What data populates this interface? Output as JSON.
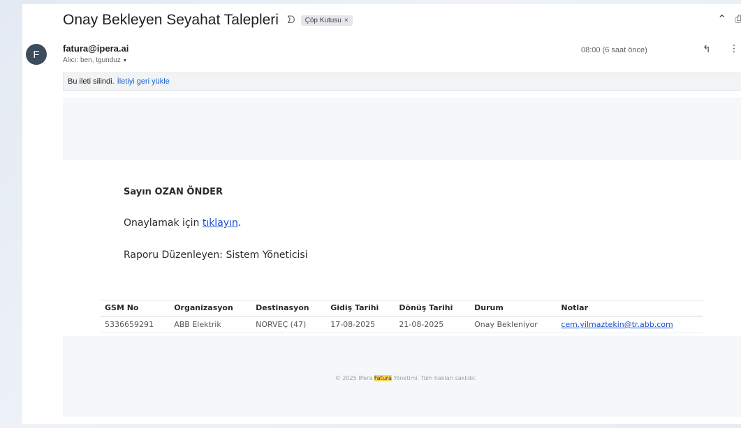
{
  "email": {
    "subject": "Onay Bekleyen Seyahat Talepleri",
    "label_chip": "Çöp Kutusu",
    "sender": "fatura@ipera.ai",
    "avatar_letter": "F",
    "recipients": "Alıcı: ben, tgunduz",
    "time": "08:00 (6 saat önce)"
  },
  "deleted_notice": {
    "text": "Bu ileti silindi.",
    "restore_link": "İletiyi geri yükle"
  },
  "body": {
    "greeting": "Sayın OZAN ÖNDER",
    "approve_prefix": "Onaylamak için ",
    "approve_link": "tıklayın",
    "approve_suffix": ".",
    "author": "Raporu Düzenleyen: Sistem Yöneticisi"
  },
  "table": {
    "headers": [
      "GSM No",
      "Organizasyon",
      "Destinasyon",
      "Gidiş Tarihi",
      "Dönüş Tarihi",
      "Durum",
      "Notlar"
    ],
    "rows": [
      [
        "5336659291",
        "ABB Elektrik",
        "NORVEÇ (47)",
        "17-08-2025",
        "21-08-2025",
        "Onay Bekleniyor",
        "cem.yilmaztekin@tr.abb.com"
      ]
    ]
  },
  "footer": {
    "prefix": "© 2025 IPera ",
    "highlight": "Fatura",
    "suffix": " Yönetimi. Tüm hakları saklıdır."
  },
  "icons": [
    "importance-icon",
    "close-chip-icon",
    "collapse-icon",
    "print-icon",
    "reply-icon",
    "more-options-icon",
    "recipients-caret-icon"
  ]
}
